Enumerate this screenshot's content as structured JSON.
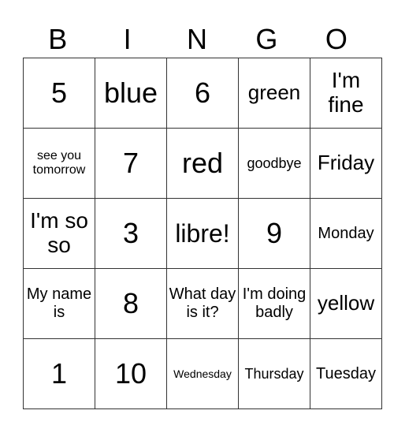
{
  "header": [
    "B",
    "I",
    "N",
    "G",
    "O"
  ],
  "rows": [
    [
      "5",
      "blue",
      "6",
      "green",
      "I'm fine"
    ],
    [
      "see you tomorrow",
      "7",
      "red",
      "goodbye",
      "Friday"
    ],
    [
      "I'm so so",
      "3",
      "libre!",
      "9",
      "Monday"
    ],
    [
      "My name is",
      "8",
      "What day is it?",
      "I'm doing badly",
      "yellow"
    ],
    [
      "1",
      "10",
      "Wednesday",
      "Thursday",
      "Tuesday"
    ]
  ]
}
